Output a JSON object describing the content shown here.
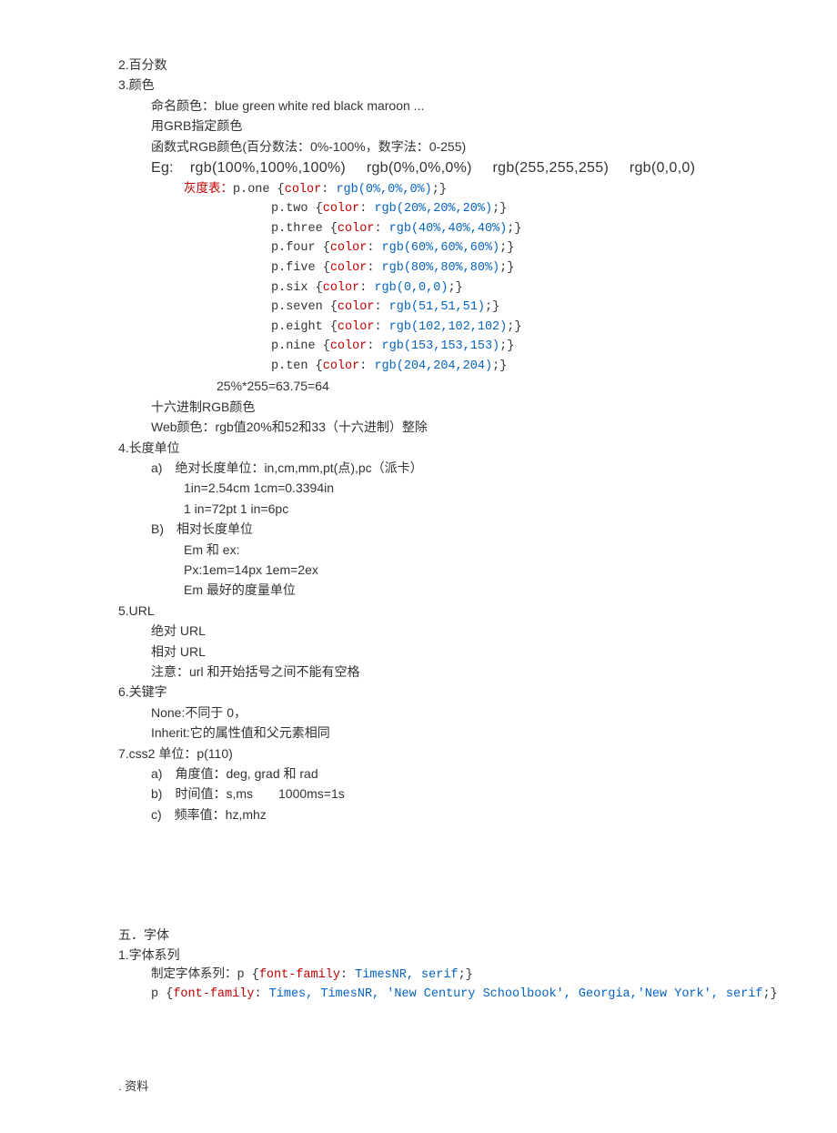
{
  "s2": {
    "title": "2.百分数"
  },
  "s3": {
    "title": "3.颜色",
    "named_colors": "命名颜色：blue green white red black maroon ...",
    "grb": "用GRB指定颜色",
    "func_rgb": "函数式RGB颜色(百分数法：0%-100%，数字法：0-255)",
    "eg_prefix": "Eg:",
    "eg_items": [
      "rgb(100%,100%,100%)",
      "rgb(0%,0%,0%)",
      "rgb(255,255,255)",
      "rgb(0,0,0)"
    ],
    "gray_label": "灰度表：",
    "gray_rules": [
      {
        "sel": "p.one",
        "prop": "color",
        "val": "rgb(0%,0%,0%)"
      },
      {
        "sel": "p.two",
        "prop": "color",
        "val": "rgb(20%,20%,20%)"
      },
      {
        "sel": "p.three",
        "prop": "color",
        "val": "rgb(40%,40%,40%)"
      },
      {
        "sel": "p.four",
        "prop": "color",
        "val": "rgb(60%,60%,60%)"
      },
      {
        "sel": "p.five",
        "prop": "color",
        "val": "rgb(80%,80%,80%)"
      },
      {
        "sel": "p.six",
        "prop": "color",
        "val": "rgb(0,0,0)"
      },
      {
        "sel": "p.seven",
        "prop": "color",
        "val": "rgb(51,51,51)"
      },
      {
        "sel": "p.eight",
        "prop": "color",
        "val": "rgb(102,102,102)"
      },
      {
        "sel": "p.nine",
        "prop": "color",
        "val": "rgb(153,153,153)"
      },
      {
        "sel": "p.ten",
        "prop": "color",
        "val": "rgb(204,204,204)"
      }
    ],
    "calc": "25%*255=63.75=64",
    "hex_rgb": "十六进制RGB颜色",
    "web_color": "Web颜色：rgb值20%和52和33（十六进制）整除"
  },
  "s4": {
    "title": "4.长度单位",
    "a_label": "a) 绝对长度单位：in,cm,mm,pt(点),pc（派卡）",
    "a_line1": "1in=2.54cm 1cm=0.3394in",
    "a_line2": "1 in=72pt 1 in=6pc",
    "b_label": "B) 相对长度单位",
    "b_line1": "Em 和 ex:",
    "b_line2": "Px:1em=14px 1em=2ex",
    "b_line3": "Em 最好的度量单位"
  },
  "s5": {
    "title": "5.URL",
    "line1": "绝对 URL",
    "line2": "相对 URL",
    "line3": "注意：url 和开始括号之间不能有空格"
  },
  "s6": {
    "title": "6.关键字",
    "line1": "None:不同于 0，",
    "line2": "Inherit:它的属性值和父元素相同"
  },
  "s7": {
    "title": "7.css2 单位：p(110)",
    "a": "a) 角度值：deg, grad  和  rad",
    "b": "b) 时间值：s,ms  1000ms=1s",
    "c": "c) 频率值：hz,mhz"
  },
  "s_font": {
    "heading": "五．字体",
    "sub1": "1.字体系列",
    "line1_prefix": "制定字体系列：",
    "rule1": {
      "sel": "p",
      "prop": "font-family",
      "val": "TimesNR, serif"
    },
    "rule2": {
      "sel": "p",
      "prop": "font-family",
      "val": "Times, TimesNR, 'New Century Schoolbook', Georgia,'New York', serif"
    }
  },
  "footer": ". 资料"
}
